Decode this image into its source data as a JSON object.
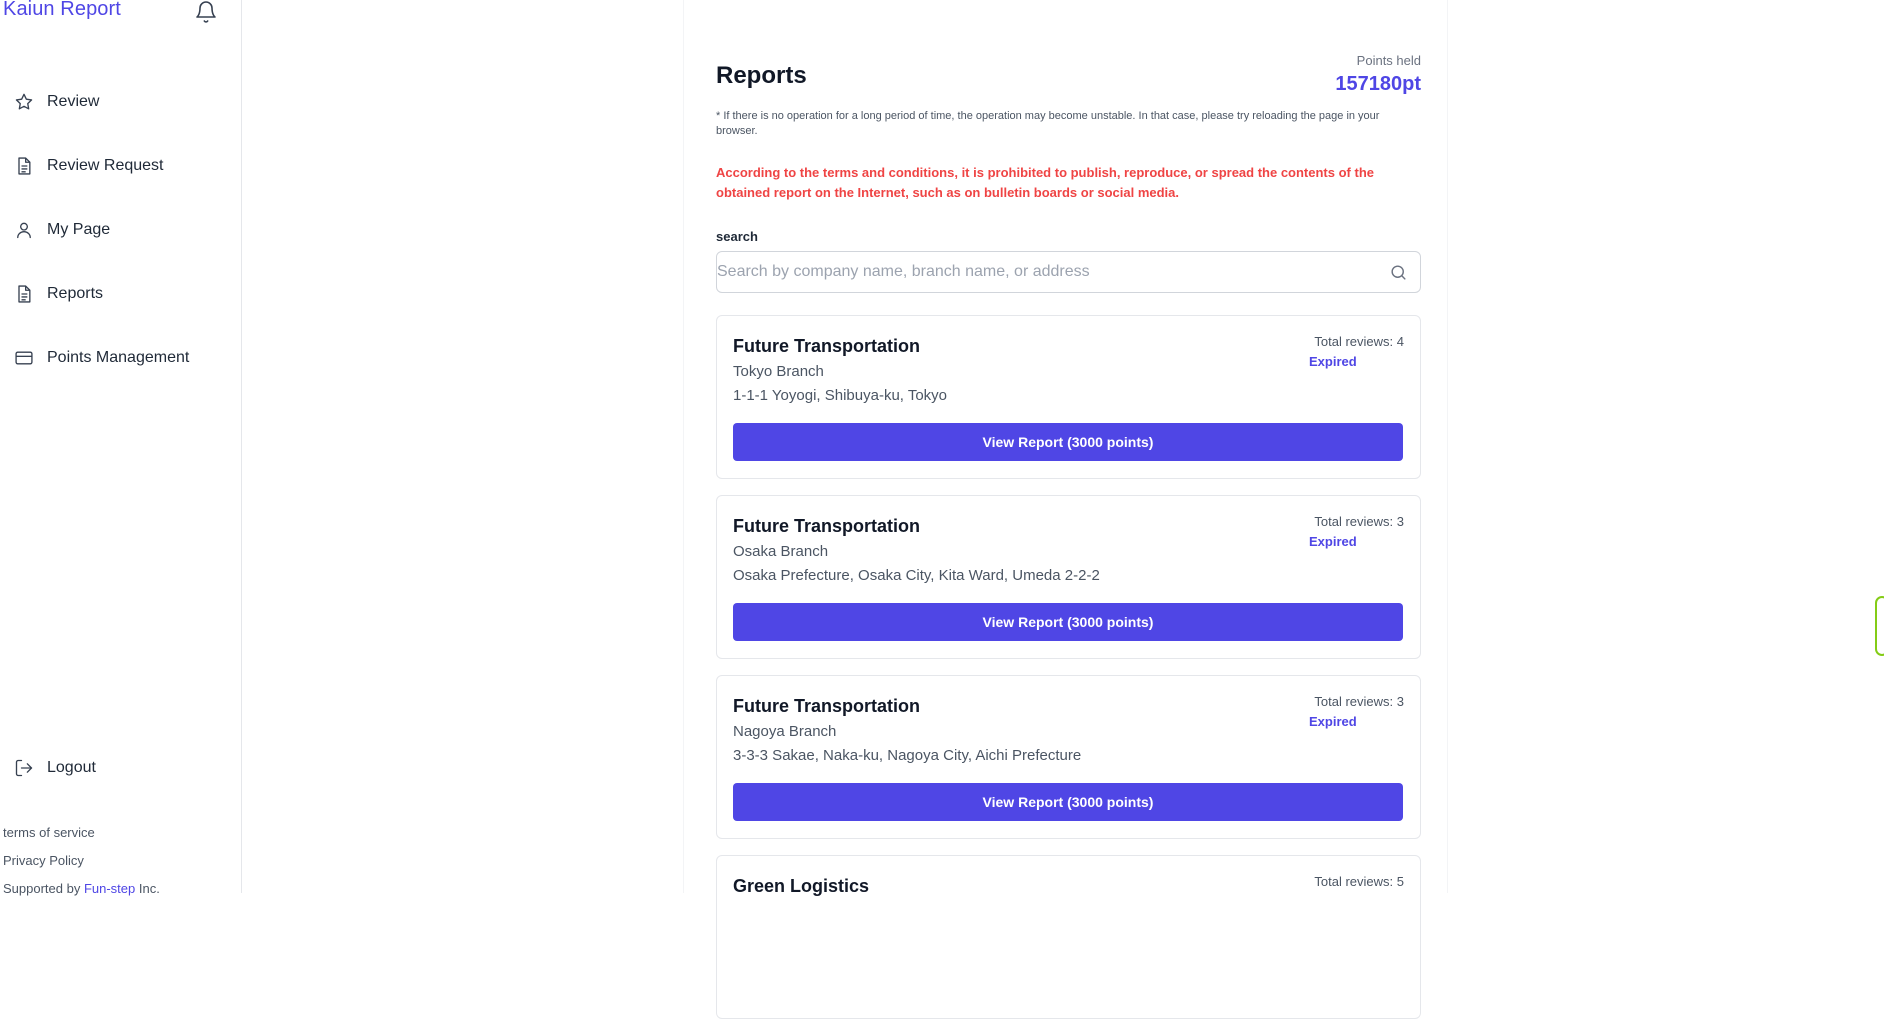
{
  "sidebar": {
    "brand": "Kaiun Report",
    "items": [
      {
        "label": "Review",
        "icon": "star-icon"
      },
      {
        "label": "Review Request",
        "icon": "document-icon"
      },
      {
        "label": "My Page",
        "icon": "user-icon"
      },
      {
        "label": "Reports",
        "icon": "document-icon"
      },
      {
        "label": "Points Management",
        "icon": "credit-card-icon"
      }
    ],
    "logout": "Logout",
    "footer": {
      "terms": "terms of service",
      "privacy": "Privacy Policy",
      "supported_prefix": "Supported by ",
      "supported_link": "Fun-step",
      "supported_suffix": " Inc."
    }
  },
  "main": {
    "title": "Reports",
    "points_label": "Points held",
    "points_value": "157180pt",
    "note": "* If there is no operation for a long period of time, the operation may become unstable. In that case, please try reloading the page in your browser.",
    "warning": "According to the terms and conditions, it is prohibited to publish, reproduce, or spread the contents of the obtained report on the Internet, such as on bulletin boards or social media.",
    "search": {
      "label": "search",
      "placeholder": "Search by company name, branch name, or address",
      "value": ""
    },
    "cards": [
      {
        "company": "Future Transportation",
        "branch": "Tokyo Branch",
        "address": "1-1-1 Yoyogi, Shibuya-ku, Tokyo",
        "total": "Total reviews: 4",
        "status": "Expired",
        "button": "View Report (3000 points)"
      },
      {
        "company": "Future Transportation",
        "branch": "Osaka Branch",
        "address": "Osaka Prefecture, Osaka City, Kita Ward, Umeda 2-2-2",
        "total": "Total reviews: 3",
        "status": "Expired",
        "button": "View Report (3000 points)"
      },
      {
        "company": "Future Transportation",
        "branch": "Nagoya Branch",
        "address": "3-3-3 Sakae, Naka-ku, Nagoya City, Aichi Prefecture",
        "total": "Total reviews: 3",
        "status": "Expired",
        "button": "View Report (3000 points)"
      },
      {
        "company": "Green Logistics",
        "branch": "",
        "address": "",
        "total": "Total reviews: 5",
        "status": "",
        "button": ""
      }
    ]
  },
  "colors": {
    "accent": "#4f46e5",
    "warning": "#ef4444"
  }
}
